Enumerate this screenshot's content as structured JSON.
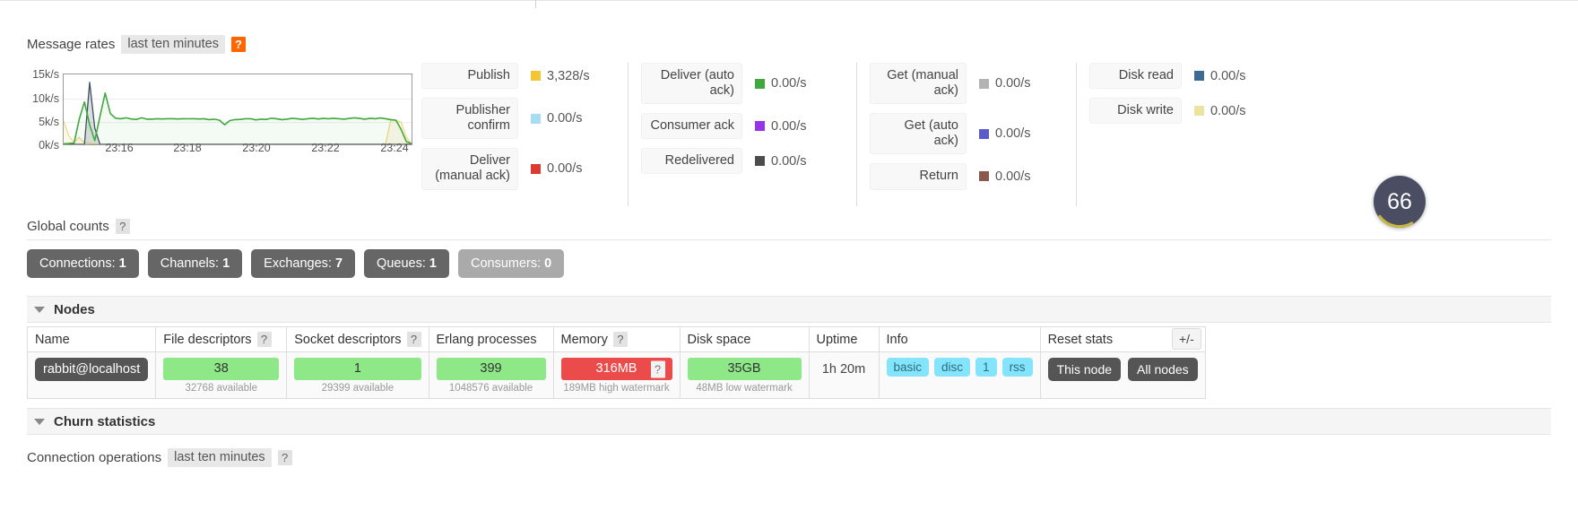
{
  "message_rates": {
    "title": "Message rates",
    "period": "last ten minutes",
    "help": "?",
    "chart": {
      "y_ticks": [
        "15k/s",
        "10k/s",
        "5k/s",
        "0k/s"
      ],
      "x_ticks": [
        "23:16",
        "23:18",
        "23:20",
        "23:22",
        "23:24"
      ]
    },
    "columns": [
      {
        "items": [
          {
            "label": "Publish",
            "value": "3,328/s",
            "color": "#f5c534"
          },
          {
            "label": "Publisher confirm",
            "value": "0.00/s",
            "color": "#a8dcf5"
          },
          {
            "label": "Deliver (manual ack)",
            "value": "0.00/s",
            "color": "#dd3b30"
          }
        ]
      },
      {
        "items": [
          {
            "label": "Deliver (auto ack)",
            "value": "0.00/s",
            "color": "#40a83f"
          },
          {
            "label": "Consumer ack",
            "value": "0.00/s",
            "color": "#9436e8"
          },
          {
            "label": "Redelivered",
            "value": "0.00/s",
            "color": "#4c4c4c"
          }
        ]
      },
      {
        "items": [
          {
            "label": "Get (manual ack)",
            "value": "0.00/s",
            "color": "#b3b3b3"
          },
          {
            "label": "Get (auto ack)",
            "value": "0.00/s",
            "color": "#5b5bcc"
          },
          {
            "label": "Return",
            "value": "0.00/s",
            "color": "#8a5a4e"
          }
        ]
      },
      {
        "items": [
          {
            "label": "Disk read",
            "value": "0.00/s",
            "color": "#3d6b96"
          },
          {
            "label": "Disk write",
            "value": "0.00/s",
            "color": "#ece3a0"
          }
        ]
      }
    ]
  },
  "global_counts": {
    "title": "Global counts",
    "help": "?",
    "buttons": [
      {
        "label": "Connections:",
        "value": "1",
        "muted": false
      },
      {
        "label": "Channels:",
        "value": "1",
        "muted": false
      },
      {
        "label": "Exchanges:",
        "value": "7",
        "muted": false
      },
      {
        "label": "Queues:",
        "value": "1",
        "muted": false
      },
      {
        "label": "Consumers:",
        "value": "0",
        "muted": true
      }
    ]
  },
  "nodes": {
    "title": "Nodes",
    "plus_minus": "+/-",
    "headers": {
      "name": "Name",
      "file_descriptors": "File descriptors",
      "socket_descriptors": "Socket descriptors",
      "erlang_processes": "Erlang processes",
      "memory": "Memory",
      "disk_space": "Disk space",
      "uptime": "Uptime",
      "info": "Info",
      "reset_stats": "Reset stats",
      "help": "?"
    },
    "row": {
      "name": "rabbit@localhost",
      "file_descriptors": {
        "value": "38",
        "sub": "32768 available"
      },
      "socket_descriptors": {
        "value": "1",
        "sub": "29399 available"
      },
      "erlang_processes": {
        "value": "399",
        "sub": "1048576 available"
      },
      "memory": {
        "value": "316MB",
        "sub": "189MB high watermark",
        "help": "?"
      },
      "disk_space": {
        "value": "35GB",
        "sub": "48MB low watermark"
      },
      "uptime": "1h 20m",
      "info_tags": [
        "basic",
        "disc",
        "1",
        "rss"
      ],
      "reset_stats": [
        "This node",
        "All nodes"
      ]
    }
  },
  "churn": {
    "title": "Churn statistics",
    "connection_operations": "Connection operations",
    "period": "last ten minutes",
    "help": "?"
  },
  "overlay_badge": {
    "text": "66"
  },
  "chart_data": {
    "type": "line",
    "title": "Message rates",
    "xlabel": "",
    "ylabel": "",
    "ylim": [
      0,
      15000
    ],
    "y_ticks": [
      0,
      5000,
      10000,
      15000
    ],
    "y_tick_labels": [
      "0k/s",
      "5k/s",
      "10k/s",
      "15k/s"
    ],
    "x_tick_labels": [
      "23:16",
      "23:18",
      "23:20",
      "23:22",
      "23:24"
    ],
    "grid": true,
    "legend": "right",
    "series": [
      {
        "name": "Publish",
        "color": "#40a83f",
        "values": [
          120,
          180,
          260,
          5400,
          9100,
          4200,
          800,
          6000,
          11000,
          6600,
          5600,
          5500,
          5700,
          5450,
          5350,
          5700,
          5400,
          5400,
          5500,
          5450,
          5500,
          5500,
          5450,
          5500,
          5480,
          5500,
          5450,
          5500,
          5300,
          5400,
          5200,
          4200,
          5100,
          5300,
          5350,
          5500,
          5500,
          5250,
          5400,
          5350,
          5600,
          5500,
          5300,
          5400,
          5600,
          5500,
          5350,
          5500,
          5600,
          5450,
          5550,
          5500,
          5600,
          5500,
          5400,
          5550,
          5700,
          5550,
          5400,
          5600,
          5500,
          5650,
          5500,
          5300,
          5200,
          3200,
          600,
          150
        ]
      },
      {
        "name": "Deliver (manual ack)",
        "color": "#3d4f5d",
        "values": [
          0,
          0,
          0,
          0,
          0,
          13300,
          3500,
          0,
          0,
          0,
          0,
          0,
          0,
          0,
          0,
          0,
          0,
          0,
          0,
          0,
          0,
          0,
          0,
          0,
          0,
          0,
          0,
          0,
          0,
          0,
          0,
          0,
          0,
          0,
          0,
          0,
          0,
          0,
          0,
          0,
          0,
          0,
          0,
          0,
          0,
          0,
          0,
          0,
          0,
          0,
          0,
          0,
          0,
          0,
          0,
          0,
          0,
          0,
          0,
          0,
          0,
          0,
          0,
          0,
          0,
          0,
          0,
          0
        ]
      },
      {
        "name": "Publisher confirm",
        "color": "#f0d98a",
        "values": [
          5000,
          1800,
          400,
          1500,
          300,
          200,
          100,
          0,
          0,
          0,
          0,
          0,
          0,
          0,
          0,
          0,
          0,
          0,
          0,
          0,
          0,
          0,
          0,
          0,
          0,
          0,
          0,
          0,
          0,
          0,
          0,
          0,
          0,
          0,
          0,
          0,
          0,
          0,
          0,
          0,
          0,
          0,
          0,
          0,
          0,
          0,
          0,
          0,
          0,
          0,
          0,
          0,
          0,
          0,
          0,
          0,
          0,
          0,
          0,
          0,
          0,
          0,
          0,
          5200,
          5100,
          4800,
          1500,
          100
        ]
      }
    ]
  }
}
